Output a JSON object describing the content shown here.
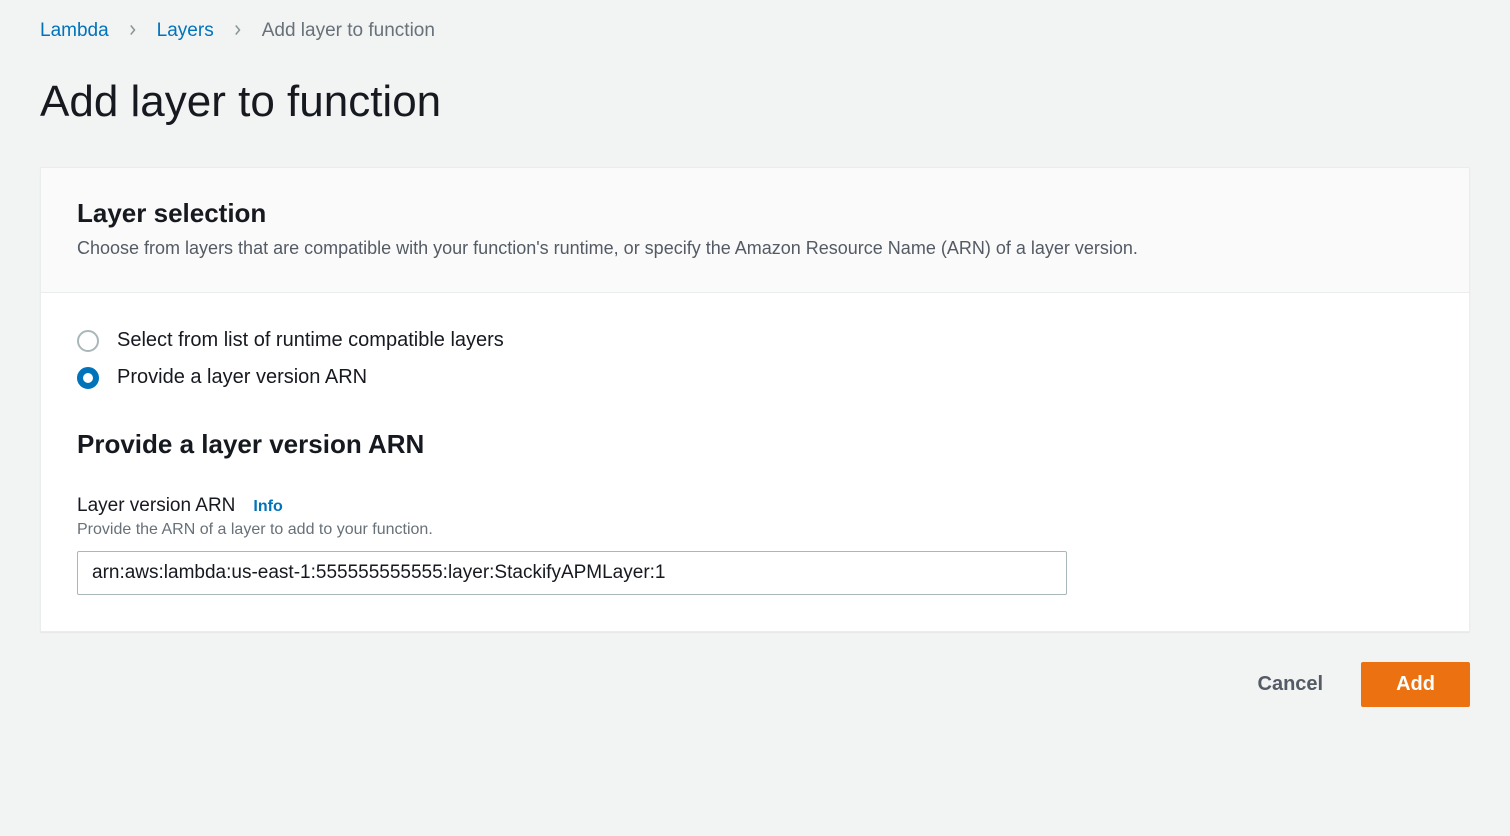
{
  "breadcrumb": {
    "items": [
      {
        "label": "Lambda"
      },
      {
        "label": "Layers"
      }
    ],
    "current": "Add layer to function"
  },
  "page_title": "Add layer to function",
  "panel": {
    "heading": "Layer selection",
    "description": "Choose from layers that are compatible with your function's runtime, or specify the Amazon Resource Name (ARN) of a layer version."
  },
  "radios": {
    "option_list": {
      "label": "Select from list of runtime compatible layers",
      "selected": false
    },
    "option_arn": {
      "label": "Provide a layer version ARN",
      "selected": true
    }
  },
  "arn_section": {
    "heading": "Provide a layer version ARN",
    "field_label": "Layer version ARN",
    "info_label": "Info",
    "hint": "Provide the ARN of a layer to add to your function.",
    "value": "arn:aws:lambda:us-east-1:555555555555:layer:StackifyAPMLayer:1"
  },
  "actions": {
    "cancel": "Cancel",
    "submit": "Add"
  }
}
